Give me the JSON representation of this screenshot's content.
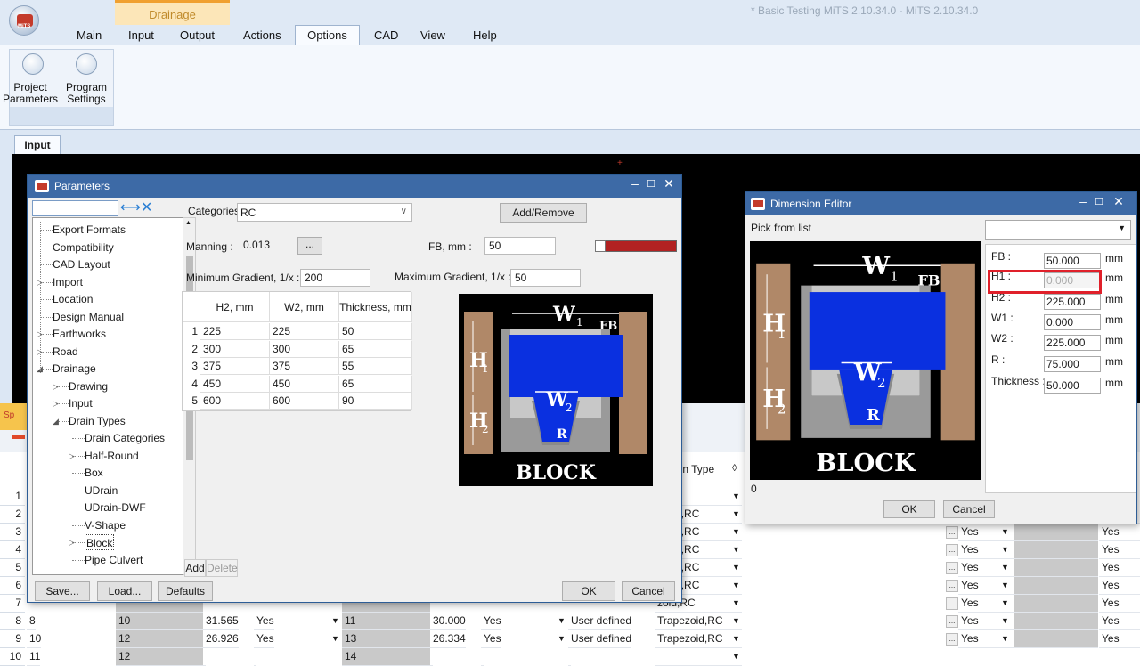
{
  "app": {
    "title": "* Basic Testing MiTS 2.10.34.0 - MiTS 2.10.34.0",
    "logo_text": "MiTS",
    "context_group": "Drainage"
  },
  "ribbon": {
    "tabs": [
      "Main",
      "Input",
      "Output",
      "Actions",
      "Options",
      "CAD",
      "View",
      "Help"
    ],
    "active_tab": "Options",
    "buttons": [
      {
        "line1": "Project",
        "line2": "Parameters"
      },
      {
        "line1": "Program",
        "line2": "Settings"
      }
    ]
  },
  "doc_tabs": {
    "input": "Input"
  },
  "orange_label": "Sp",
  "grid": {
    "right_header": "ain Type",
    "rows": [
      {
        "num": "1",
        "type": "RC"
      },
      {
        "num": "2",
        "type": "ound,RC",
        "ok": "Yes",
        "ok2": "Yes"
      },
      {
        "num": "3",
        "type": "ound,RC",
        "ok": "Yes",
        "ok2": "Yes"
      },
      {
        "num": "4",
        "type": "ound,RC",
        "ok": "Yes",
        "ok2": "Yes"
      },
      {
        "num": "5",
        "type": "ound,RC",
        "ok": "Yes",
        "ok2": "Yes"
      },
      {
        "num": "6",
        "type": "ound,RC",
        "ok": "Yes",
        "ok2": "Yes"
      },
      {
        "num": "7",
        "type": "zoid,RC",
        "ok": "Yes",
        "ok2": "Yes"
      },
      {
        "num": "8",
        "c1": "8",
        "c2": "10",
        "c3": "31.565",
        "c4": "Yes",
        "c5": "11",
        "c6": "30.000",
        "c7": "Yes",
        "c8": "User defined",
        "type": "Trapezoid,RC",
        "ok": "Yes",
        "ok2": "Yes"
      },
      {
        "num": "9",
        "c1": "10",
        "c2": "12",
        "c3": "26.926",
        "c4": "Yes",
        "c5": "13",
        "c6": "26.334",
        "c7": "Yes",
        "c8": "User defined",
        "type": "Trapezoid,RC",
        "ok": "Yes",
        "ok2": "Yes"
      },
      {
        "num": "10",
        "c1": "11",
        "c2": "12",
        "c3": "",
        "c4": "",
        "c5": "14",
        "c6": "",
        "c7": "",
        "c8": "",
        "type": "",
        "ok": "",
        "ok2": ""
      }
    ]
  },
  "params": {
    "title": "Parameters",
    "tree": [
      {
        "label": "Export Formats",
        "indent": 0,
        "exp": ""
      },
      {
        "label": "Compatibility",
        "indent": 0,
        "exp": ""
      },
      {
        "label": "CAD Layout",
        "indent": 0,
        "exp": ""
      },
      {
        "label": "Import",
        "indent": 0,
        "exp": "▷"
      },
      {
        "label": "Location",
        "indent": 0,
        "exp": ""
      },
      {
        "label": "Design Manual",
        "indent": 0,
        "exp": ""
      },
      {
        "label": "Earthworks",
        "indent": 0,
        "exp": "▷"
      },
      {
        "label": "Road",
        "indent": 0,
        "exp": "▷"
      },
      {
        "label": "Drainage",
        "indent": 0,
        "exp": "◢"
      },
      {
        "label": "Drawing",
        "indent": 1,
        "exp": "▷"
      },
      {
        "label": "Input",
        "indent": 1,
        "exp": "▷"
      },
      {
        "label": "Drain Types",
        "indent": 1,
        "exp": "◢"
      },
      {
        "label": "Drain Categories",
        "indent": 2,
        "exp": ""
      },
      {
        "label": "Half-Round",
        "indent": 2,
        "exp": "▷"
      },
      {
        "label": "Box",
        "indent": 2,
        "exp": ""
      },
      {
        "label": "UDrain",
        "indent": 2,
        "exp": ""
      },
      {
        "label": "UDrain-DWF",
        "indent": 2,
        "exp": ""
      },
      {
        "label": "V-Shape",
        "indent": 2,
        "exp": ""
      },
      {
        "label": "Block",
        "indent": 2,
        "exp": "▷",
        "selected": true
      },
      {
        "label": "Pipe Culvert",
        "indent": 2,
        "exp": ""
      }
    ],
    "categories_label": "Categories",
    "category_value": "RC",
    "add_remove": "Add/Remove",
    "manning_label": "Manning :",
    "manning_value": "0.013",
    "ellipsis": "...",
    "fb_label": "FB, mm :",
    "fb_value": "50",
    "min_grad_label": "Minimum Gradient, 1/x :",
    "min_grad_value": "200",
    "max_grad_label": "Maximum Gradient, 1/x :",
    "max_grad_value": "50",
    "table_headers": [
      "H2, mm",
      "W2, mm",
      "Thickness, mm"
    ],
    "table_rows": [
      [
        "1",
        "225",
        "225",
        "50"
      ],
      [
        "2",
        "300",
        "300",
        "65"
      ],
      [
        "3",
        "375",
        "375",
        "55"
      ],
      [
        "4",
        "450",
        "450",
        "65"
      ],
      [
        "5",
        "600",
        "600",
        "90"
      ]
    ],
    "add": "Add",
    "delete": "Delete",
    "save": "Save...",
    "load": "Load...",
    "defaults": "Defaults",
    "ok": "OK",
    "cancel": "Cancel",
    "colors": {
      "swatch": "#b22222",
      "title_bar": "#3d6aa6"
    }
  },
  "diagram": {
    "w1": "W",
    "w1sub": "1",
    "fb": "FB",
    "h1": "H",
    "h1sub": "1",
    "w2": "W",
    "w2sub": "2",
    "h2": "H",
    "h2sub": "2",
    "r": "R",
    "caption": "BLOCK"
  },
  "dim_editor": {
    "title": "Dimension Editor",
    "pick_label": "Pick from list",
    "status": "0",
    "fields": [
      {
        "label": "FB :",
        "value": "50.000",
        "unit": "mm"
      },
      {
        "label": "H1 :",
        "value": "0.000",
        "unit": "mm",
        "disabled": true
      },
      {
        "label": "H2 :",
        "value": "225.000",
        "unit": "mm"
      },
      {
        "label": "W1 :",
        "value": "0.000",
        "unit": "mm"
      },
      {
        "label": "W2 :",
        "value": "225.000",
        "unit": "mm"
      },
      {
        "label": "R :",
        "value": "75.000",
        "unit": "mm"
      },
      {
        "label": "Thickness :",
        "value": "50.000",
        "unit": "mm"
      }
    ],
    "ok": "OK",
    "cancel": "Cancel"
  }
}
